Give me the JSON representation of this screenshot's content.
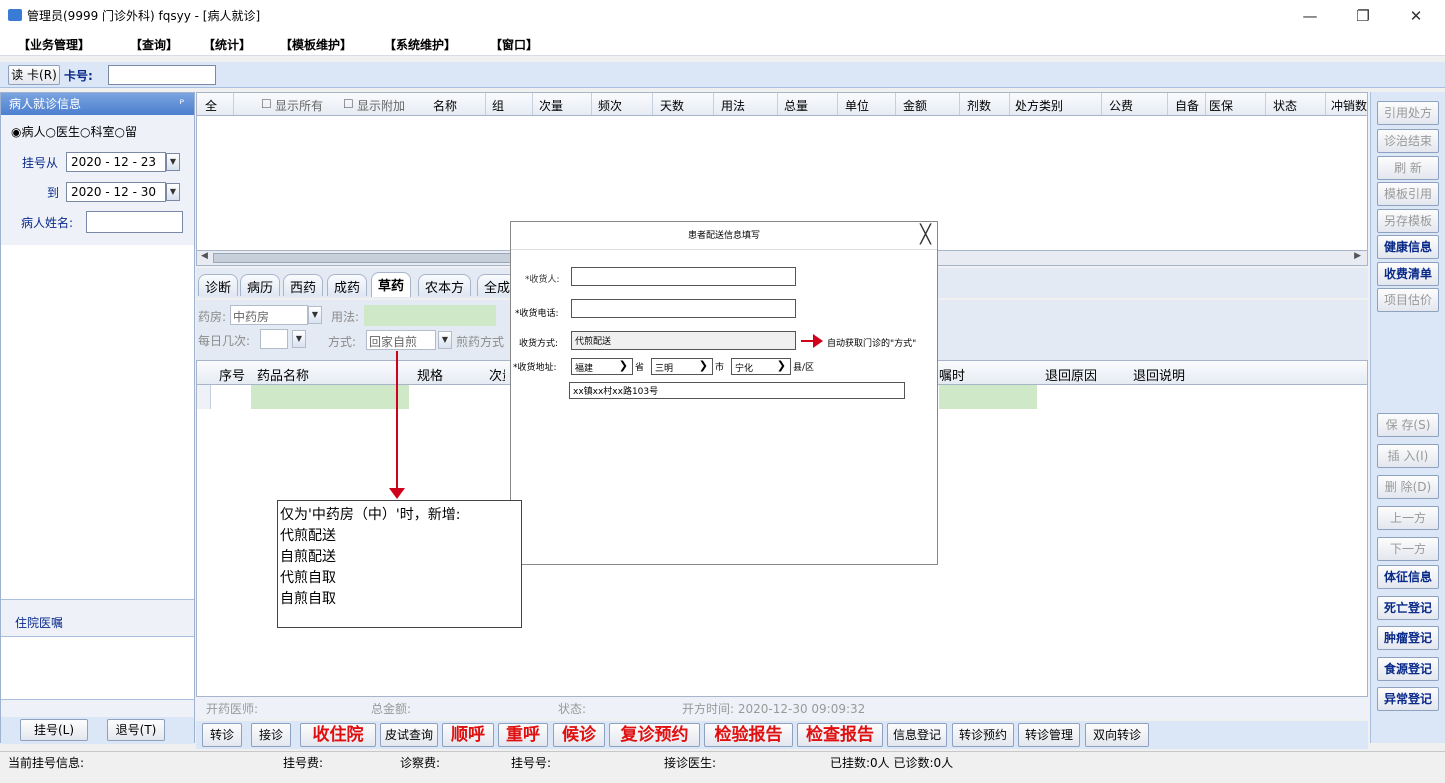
{
  "window": {
    "title": "管理员(9999 门诊外科) fqsyy - [病人就诊]",
    "minimize": "—",
    "restore": "❐",
    "close": "✕"
  },
  "menu": [
    "【业务管理】",
    "【查询】",
    "【统计】",
    "【模板维护】",
    "【系统维护】",
    "【窗口】"
  ],
  "cardbar": {
    "read_card": "读 卡(R)",
    "card_no_label": "卡号:",
    "card_no_value": ""
  },
  "left": {
    "panel_title": "病人就诊信息",
    "pin": "ᴾ",
    "radios": [
      "病人",
      "医生",
      "科室",
      "留"
    ],
    "reg_from_label": "挂号从",
    "reg_from": "2020 - 12 - 23",
    "reg_to_label": "到",
    "reg_to": "2020 - 12 - 30",
    "patient_name_label": "病人姓名:",
    "patient_name_value": "",
    "inpatient_label": "住院医嘱",
    "btn_register": "挂号(L)",
    "btn_unregister": "退号(T)"
  },
  "grid_top": {
    "all": "全",
    "show_all": "显示所有",
    "show_extra": "显示附加",
    "columns": [
      "名称",
      "组",
      "次量",
      "频次",
      "天数",
      "用法",
      "总量",
      "单位",
      "金额",
      "剂数",
      "处方类别",
      "公费",
      "自备",
      "医保",
      "状态",
      "冲销数"
    ]
  },
  "tabs": [
    "诊断",
    "病历",
    "西药",
    "成药",
    "草药",
    "农本方",
    "全成"
  ],
  "active_tab": "草药",
  "form": {
    "pharmacy_label": "药房:",
    "pharmacy_value": "中药房",
    "usage_label": "用法:",
    "times_label": "每日几次:",
    "mode_label": "方式:",
    "mode_value": "回家自煎",
    "decoct_label": "煎药方式"
  },
  "grid_bottom": {
    "columns": [
      "序号",
      "药品名称",
      "规格",
      "次量",
      "嘱时",
      "退回原因",
      "退回说明"
    ]
  },
  "status_inner": {
    "doctor": "开药医师:",
    "total": "总金额:",
    "status": "状态:",
    "time": "开方时间: 2020-12-30 09:09:32"
  },
  "bottom_buttons": [
    {
      "label": "转诊",
      "red": false
    },
    {
      "label": "接诊",
      "red": false
    },
    {
      "label": "收住院",
      "red": true
    },
    {
      "label": "皮试查询",
      "red": false
    },
    {
      "label": "顺呼",
      "red": true
    },
    {
      "label": "重呼",
      "red": true
    },
    {
      "label": "候诊",
      "red": true
    },
    {
      "label": "复诊预约",
      "red": true
    },
    {
      "label": "检验报告",
      "red": true
    },
    {
      "label": "检查报告",
      "red": true
    },
    {
      "label": "信息登记",
      "red": false
    },
    {
      "label": "转诊预约",
      "red": false
    },
    {
      "label": "转诊管理",
      "red": false
    },
    {
      "label": "双向转诊",
      "red": false
    }
  ],
  "right_buttons_top": [
    {
      "label": "引用处方",
      "active": false
    },
    {
      "label": "诊治结束",
      "active": false
    },
    {
      "label": "刷 新",
      "active": false
    },
    {
      "label": "模板引用",
      "active": false
    },
    {
      "label": "另存模板",
      "active": false
    },
    {
      "label": "健康信息",
      "active": true
    },
    {
      "label": "收费清单",
      "active": true
    },
    {
      "label": "项目估价",
      "active": false
    }
  ],
  "right_buttons_bottom": [
    {
      "label": "保 存(S)",
      "active": false
    },
    {
      "label": "插 入(I)",
      "active": false
    },
    {
      "label": "删 除(D)",
      "active": false
    },
    {
      "label": "上一方",
      "active": false
    },
    {
      "label": "下一方",
      "active": false
    },
    {
      "label": "体征信息",
      "active": true
    },
    {
      "label": "死亡登记",
      "active": true
    },
    {
      "label": "肿瘤登记",
      "active": true
    },
    {
      "label": "食源登记",
      "active": true
    },
    {
      "label": "异常登记",
      "active": true
    }
  ],
  "statusbar": {
    "current": "当前挂号信息:",
    "fee": "挂号费:",
    "exam_fee": "诊察费:",
    "reg_no": "挂号号:",
    "doctor": "接诊医生:",
    "counts": "已挂数:0人 已诊数:0人"
  },
  "dialog": {
    "title": "患者配送信息填写",
    "close": "╳",
    "receiver_label": "*收货人:",
    "receiver_value": "",
    "phone_label": "*收货电话:",
    "phone_value": "",
    "method_label": "收货方式:",
    "method_value": "代煎配送",
    "method_note": "自动获取门诊的\"方式\"",
    "address_label": "*收货地址:",
    "province": "福建",
    "province_unit": "省",
    "city": "三明",
    "city_unit": "市",
    "county": "宁化",
    "county_unit": "县/区",
    "street": "xx镇xx村xx路103号"
  },
  "annotation": {
    "lines": [
      "仅为'中药房（中）'时，新增:",
      "代煎配送",
      "自煎配送",
      "代煎自取",
      "自煎自取"
    ]
  }
}
